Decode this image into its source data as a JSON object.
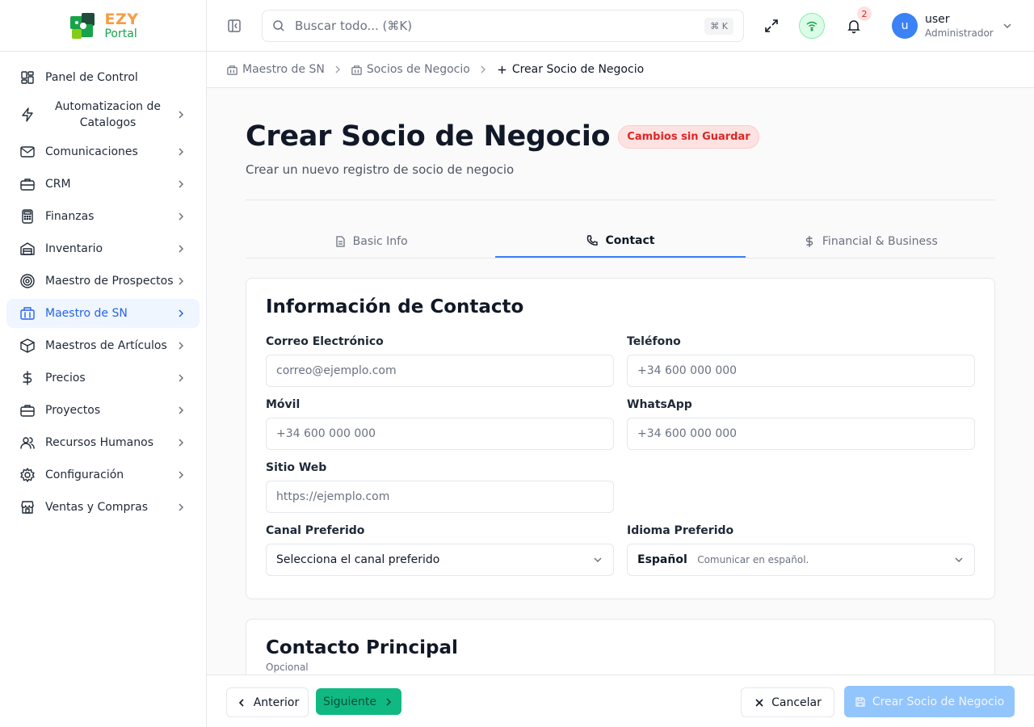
{
  "brand": {
    "line1": "EZY",
    "line2": "Portal"
  },
  "sidebar": {
    "items": [
      {
        "label": "Panel de Control",
        "icon": "dashboard-icon",
        "chevron": false,
        "active": false
      },
      {
        "label": "Automatizacion de Catalogos",
        "icon": "lightning-icon",
        "chevron": true,
        "active": false
      },
      {
        "label": "Comunicaciones",
        "icon": "mail-icon",
        "chevron": true,
        "active": false
      },
      {
        "label": "CRM",
        "icon": "briefcase-icon",
        "chevron": true,
        "active": false
      },
      {
        "label": "Finanzas",
        "icon": "calculator-icon",
        "chevron": true,
        "active": false
      },
      {
        "label": "Inventario",
        "icon": "warehouse-icon",
        "chevron": true,
        "active": false
      },
      {
        "label": "Maestro de Prospectos",
        "icon": "target-icon",
        "chevron": true,
        "active": false
      },
      {
        "label": "Maestro de SN",
        "icon": "building-icon",
        "chevron": true,
        "active": true
      },
      {
        "label": "Maestros de Artículos",
        "icon": "box-icon",
        "chevron": true,
        "active": false
      },
      {
        "label": "Precios",
        "icon": "dollar-icon",
        "chevron": true,
        "active": false
      },
      {
        "label": "Proyectos",
        "icon": "briefcase-icon",
        "chevron": true,
        "active": false
      },
      {
        "label": "Recursos Humanos",
        "icon": "users-icon",
        "chevron": true,
        "active": false
      },
      {
        "label": "Configuración",
        "icon": "gear-icon",
        "chevron": true,
        "active": false
      },
      {
        "label": "Ventas y Compras",
        "icon": "store-icon",
        "chevron": true,
        "active": false
      }
    ]
  },
  "header": {
    "search_placeholder": "Buscar todo... (⌘K)",
    "search_shortcut": "⌘ K",
    "notification_count": "2",
    "user_name": "user",
    "user_role": "Administrador",
    "avatar_initial": "u"
  },
  "breadcrumb": {
    "items": [
      "Maestro de SN",
      "Socios de Negocio",
      "Crear Socio de Negocio"
    ]
  },
  "page": {
    "title": "Crear Socio de Negocio",
    "status_badge": "Cambios sin Guardar",
    "subtitle": "Crear un nuevo registro de socio de negocio"
  },
  "tabs": [
    {
      "label": "Basic Info",
      "icon": "document-icon",
      "active": false
    },
    {
      "label": "Contact",
      "icon": "phone-icon",
      "active": true
    },
    {
      "label": "Financial & Business",
      "icon": "dollar-icon",
      "active": false
    }
  ],
  "contact_card": {
    "title": "Información de Contacto",
    "fields": {
      "email": {
        "label": "Correo Electrónico",
        "placeholder": "correo@ejemplo.com"
      },
      "phone": {
        "label": "Teléfono",
        "placeholder": "+34 600 000 000"
      },
      "mobile": {
        "label": "Móvil",
        "placeholder": "+34 600 000 000"
      },
      "whatsapp": {
        "label": "WhatsApp",
        "placeholder": "+34 600 000 000"
      },
      "website": {
        "label": "Sitio Web",
        "placeholder": "https://ejemplo.com"
      },
      "channel": {
        "label": "Canal Preferido",
        "value": "Selecciona el canal preferido"
      },
      "language": {
        "label": "Idioma Preferido",
        "value": "Español",
        "description": "Comunicar en español."
      }
    }
  },
  "primary_contact_card": {
    "title": "Contacto Principal",
    "subtitle": "Opcional"
  },
  "footer": {
    "prev_label": "Anterior",
    "next_label": "Siguiente",
    "cancel_label": "Cancelar",
    "create_label": "Crear Socio de Negocio"
  },
  "colors": {
    "accent": "#3b82f6",
    "active_nav_bg": "#eff6ff",
    "next_button": "#10b981",
    "create_button_disabled": "#93c5fd",
    "unsaved_badge": "#dc2626"
  }
}
